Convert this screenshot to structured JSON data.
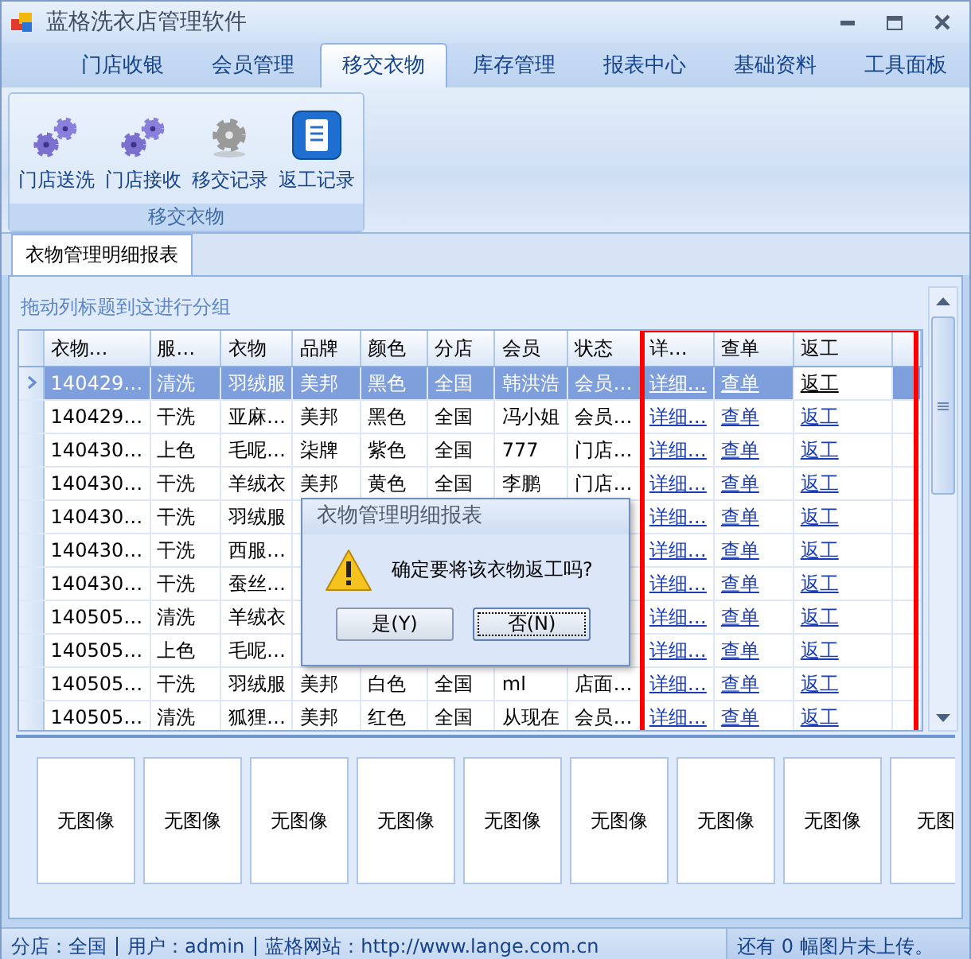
{
  "window": {
    "title": "蓝格洗衣店管理软件"
  },
  "tabs": [
    {
      "label": "门店收银",
      "selected": false
    },
    {
      "label": "会员管理",
      "selected": false
    },
    {
      "label": "移交衣物",
      "selected": true
    },
    {
      "label": "库存管理",
      "selected": false
    },
    {
      "label": "报表中心",
      "selected": false
    },
    {
      "label": "基础资料",
      "selected": false
    },
    {
      "label": "工具面板",
      "selected": false
    }
  ],
  "ribbon_group": {
    "caption": "移交衣物",
    "buttons": [
      {
        "label": "门店送洗",
        "kind": "gears"
      },
      {
        "label": "门店接收",
        "kind": "gears"
      },
      {
        "label": "移交记录",
        "kind": "gear"
      },
      {
        "label": "返工记录",
        "kind": "document"
      }
    ]
  },
  "document_tab": {
    "label": "衣物管理明细报表",
    "selected": true
  },
  "group_panel_hint": "拖动列标题到这进行分组",
  "grid": {
    "columns": [
      {
        "label": "衣物…",
        "kind": "text"
      },
      {
        "label": "服…",
        "kind": "text"
      },
      {
        "label": "衣物",
        "kind": "text"
      },
      {
        "label": "品牌",
        "kind": "text"
      },
      {
        "label": "颜色",
        "kind": "text"
      },
      {
        "label": "分店",
        "kind": "text"
      },
      {
        "label": "会员",
        "kind": "text"
      },
      {
        "label": "状态",
        "kind": "text"
      },
      {
        "label": "详…",
        "kind": "link"
      },
      {
        "label": "查单",
        "kind": "link"
      },
      {
        "label": "返工",
        "kind": "link"
      }
    ],
    "highlight_box": true,
    "rows": [
      {
        "selected": true,
        "cells": [
          "140429…",
          "清洗",
          "羽绒服",
          "美邦",
          "黑色",
          "全国",
          "韩洪浩",
          "会员…"
        ],
        "links": [
          {
            "label": "详细…",
            "focused": false
          },
          {
            "label": "查单",
            "focused": false
          },
          {
            "label": "返工",
            "focused": true
          }
        ]
      },
      {
        "selected": false,
        "cells": [
          "140429…",
          "干洗",
          "亚麻…",
          "美邦",
          "黑色",
          "全国",
          "冯小姐",
          "会员…"
        ],
        "links": [
          {
            "label": "详细…",
            "focused": false
          },
          {
            "label": "查单",
            "focused": false
          },
          {
            "label": "返工",
            "focused": false
          }
        ]
      },
      {
        "selected": false,
        "cells": [
          "140430…",
          "上色",
          "毛呢…",
          "柒牌",
          "紫色",
          "全国",
          "777",
          "门店…"
        ],
        "links": [
          {
            "label": "详细…",
            "focused": false
          },
          {
            "label": "查单",
            "focused": false
          },
          {
            "label": "返工",
            "focused": false
          }
        ]
      },
      {
        "selected": false,
        "cells": [
          "140430…",
          "干洗",
          "羊绒衣",
          "美邦",
          "黄色",
          "全国",
          "李鹏",
          "门店…"
        ],
        "links": [
          {
            "label": "详细…",
            "focused": false
          },
          {
            "label": "查单",
            "focused": false
          },
          {
            "label": "返工",
            "focused": false
          }
        ]
      },
      {
        "selected": false,
        "cells": [
          "140430…",
          "干洗",
          "羽绒服"
        ],
        "links": [
          {
            "label": "详细…",
            "focused": false
          },
          {
            "label": "查单",
            "focused": false
          },
          {
            "label": "返工",
            "focused": false
          }
        ]
      },
      {
        "selected": false,
        "cells": [
          "140430…",
          "干洗",
          "西服…"
        ],
        "links": [
          {
            "label": "详细…",
            "focused": false
          },
          {
            "label": "查单",
            "focused": false
          },
          {
            "label": "返工",
            "focused": false
          }
        ]
      },
      {
        "selected": false,
        "cells": [
          "140430…",
          "干洗",
          "蚕丝…"
        ],
        "links": [
          {
            "label": "详细…",
            "focused": false
          },
          {
            "label": "查单",
            "focused": false
          },
          {
            "label": "返工",
            "focused": false
          }
        ]
      },
      {
        "selected": false,
        "cells": [
          "140505…",
          "清洗",
          "羊绒衣"
        ],
        "links": [
          {
            "label": "详细…",
            "focused": false
          },
          {
            "label": "查单",
            "focused": false
          },
          {
            "label": "返工",
            "focused": false
          }
        ]
      },
      {
        "selected": false,
        "cells": [
          "140505…",
          "上色",
          "毛呢…"
        ],
        "links": [
          {
            "label": "详细…",
            "focused": false
          },
          {
            "label": "查单",
            "focused": false
          },
          {
            "label": "返工",
            "focused": false
          }
        ]
      },
      {
        "selected": false,
        "cells": [
          "140505…",
          "干洗",
          "羽绒服",
          "美邦",
          "白色",
          "全国",
          "ml",
          "店面…"
        ],
        "links": [
          {
            "label": "详细…",
            "focused": false
          },
          {
            "label": "查单",
            "focused": false
          },
          {
            "label": "返工",
            "focused": false
          }
        ]
      },
      {
        "selected": false,
        "cells": [
          "140505…",
          "清洗",
          "狐狸…",
          "美邦",
          "红色",
          "全国",
          "从现在",
          "会员…"
        ],
        "links": [
          {
            "label": "详细…",
            "focused": false
          },
          {
            "label": "查单",
            "focused": false
          },
          {
            "label": "返工",
            "focused": false
          }
        ]
      }
    ]
  },
  "dialog": {
    "title": "衣物管理明细报表",
    "message": "确定要将该衣物返工吗?",
    "buttons": [
      {
        "label": "是(Y)",
        "selected": false
      },
      {
        "label": "否(N)",
        "selected": true
      }
    ]
  },
  "images": [
    "无图像",
    "无图像",
    "无图像",
    "无图像",
    "无图像",
    "无图像",
    "无图像",
    "无图像",
    "无图"
  ],
  "status_bar": {
    "items": [
      "分店：全国",
      "用户：admin",
      "蓝格网站：http://www.lange.com.cn"
    ],
    "right": "还有 0 幅图片未上传。"
  }
}
